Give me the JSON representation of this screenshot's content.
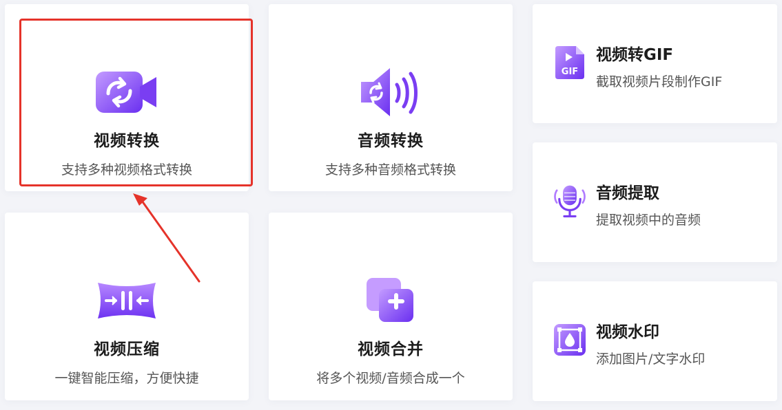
{
  "colors": {
    "accent_purple": "#7b3ff2",
    "accent_violet_light": "#b17cff",
    "highlight_red": "#e5332a"
  },
  "tools": [
    {
      "title": "视频转换",
      "desc": "支持多种视频格式转换",
      "icon": "video-convert-icon"
    },
    {
      "title": "音频转换",
      "desc": "支持多种音频格式转换",
      "icon": "audio-convert-icon"
    },
    {
      "title": "视频压缩",
      "desc": "一键智能压缩，方便快捷",
      "icon": "video-compress-icon"
    },
    {
      "title": "视频合并",
      "desc": "将多个视频/音频合成一个",
      "icon": "video-merge-icon"
    }
  ],
  "side_tools": [
    {
      "title": "视频转GIF",
      "desc": "截取视频片段制作GIF",
      "icon": "gif-file-icon",
      "icon_text": "GIF"
    },
    {
      "title": "音频提取",
      "desc": "提取视频中的音频",
      "icon": "microphone-icon"
    },
    {
      "title": "视频水印",
      "desc": "添加图片/文字水印",
      "icon": "watermark-icon"
    }
  ]
}
